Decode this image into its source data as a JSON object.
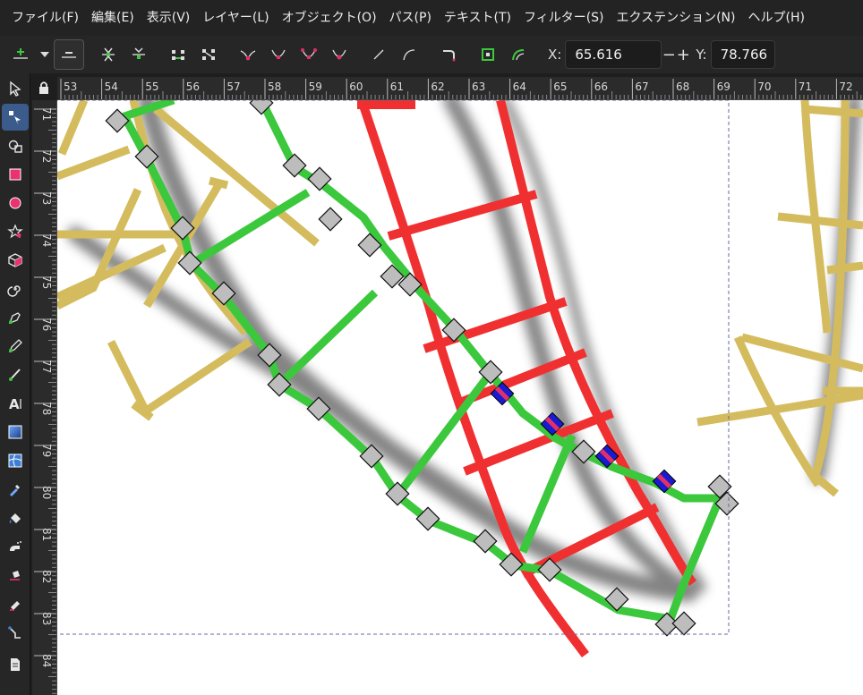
{
  "menu": {
    "items": [
      "ファイル(F)",
      "編集(E)",
      "表示(V)",
      "レイヤー(L)",
      "オブジェクト(O)",
      "パス(P)",
      "テキスト(T)",
      "フィルター(S)",
      "エクステンション(N)",
      "ヘルプ(H)"
    ]
  },
  "toolbar": {
    "x_label": "X:",
    "x_value": "65.616",
    "minus": "−",
    "plus": "+",
    "y_label": "Y:",
    "y_value": "78.766"
  },
  "ruler": {
    "horizontal_ticks": [
      "53",
      "54",
      "55",
      "56",
      "57",
      "58",
      "59",
      "60",
      "61",
      "62",
      "63",
      "64",
      "65",
      "66",
      "67",
      "68",
      "69",
      "70",
      "71",
      "72"
    ],
    "vertical_ticks": [
      "71",
      "72",
      "73",
      "74",
      "75",
      "76",
      "77",
      "78",
      "79",
      "80",
      "81",
      "82",
      "83",
      "84"
    ]
  },
  "tools": [
    "selector",
    "node",
    "tweak",
    "rectangle",
    "circle",
    "star",
    "box3d",
    "spiral",
    "pen",
    "pencil",
    "calligraphy",
    "text",
    "gradient",
    "mesh",
    "dropper",
    "paint-bucket",
    "spray",
    "eraser",
    "connector",
    "pages"
  ],
  "colors": {
    "green_path": "#3cc83c",
    "red_path": "#f03030",
    "tan_path": "#d4bc5e",
    "shadow": "#6e6e6e",
    "node_fill": "#bdbdbd",
    "active_tool": "#3a5b8c"
  }
}
